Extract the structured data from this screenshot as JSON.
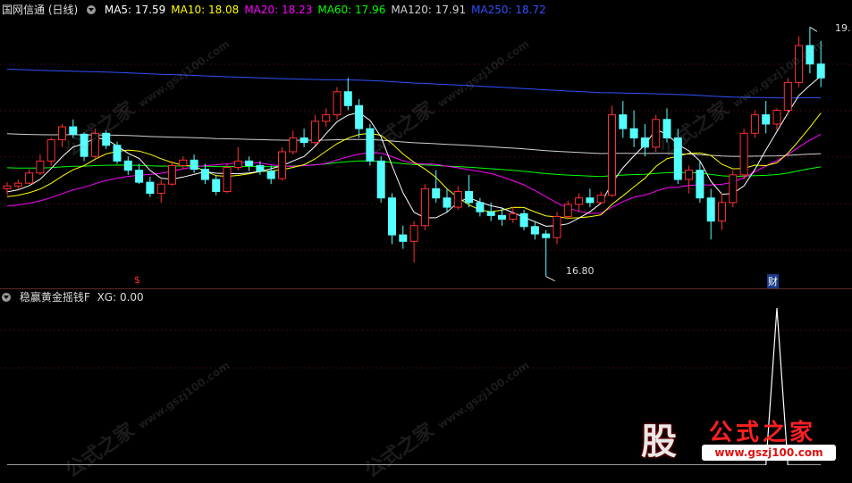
{
  "header": {
    "title": "国网信通 (日线)",
    "ma_items": [
      {
        "label": "MA5: 17.59",
        "color": "#ffffff"
      },
      {
        "label": "MA10: 18.08",
        "color": "#ffff00"
      },
      {
        "label": "MA20: 18.23",
        "color": "#ff00ff"
      },
      {
        "label": "MA60: 17.96",
        "color": "#00ff00"
      },
      {
        "label": "MA120: 17.91",
        "color": "#d0d0d0"
      },
      {
        "label": "MA250: 18.72",
        "color": "#3050ff"
      }
    ]
  },
  "indicator": {
    "title": "稳赢黄金摇钱F",
    "value_label": "XG: 0.00"
  },
  "annotations": {
    "high_label": "19.",
    "low_label": "16.80",
    "marker_s": "$",
    "marker_cai": "财"
  },
  "watermark": {
    "text": "公式之家",
    "url": "www.gszj100.com"
  },
  "logo": {
    "char": "股",
    "text": "公式之家",
    "url": "www.gszj100.com"
  },
  "colors": {
    "up": "#ff3030",
    "down": "#54ffff",
    "ma5": "#ffffff",
    "ma10": "#ffff00",
    "ma20": "#ff00ff",
    "ma60": "#00ff00",
    "ma120": "#d0d0d0",
    "ma250": "#3050ff"
  },
  "chart_data": [
    {
      "type": "candlestick",
      "title": "国网信通 (日线)",
      "series_ohlc": [
        [
          17.75,
          17.82,
          17.68,
          17.78
        ],
        [
          17.78,
          17.85,
          17.74,
          17.81
        ],
        [
          17.81,
          17.96,
          17.8,
          17.92
        ],
        [
          17.92,
          18.12,
          17.9,
          18.05
        ],
        [
          18.05,
          18.3,
          18.0,
          18.28
        ],
        [
          18.28,
          18.45,
          18.2,
          18.42
        ],
        [
          18.42,
          18.5,
          18.3,
          18.34
        ],
        [
          18.34,
          18.36,
          18.05,
          18.1
        ],
        [
          18.1,
          18.4,
          18.08,
          18.35
        ],
        [
          18.35,
          18.38,
          18.18,
          18.22
        ],
        [
          18.22,
          18.26,
          18.02,
          18.05
        ],
        [
          18.05,
          18.1,
          17.9,
          17.95
        ],
        [
          17.95,
          18.02,
          17.8,
          17.82
        ],
        [
          17.82,
          17.88,
          17.66,
          17.7
        ],
        [
          17.7,
          17.85,
          17.6,
          17.8
        ],
        [
          17.8,
          18.05,
          17.78,
          18.0
        ],
        [
          18.0,
          18.1,
          17.96,
          18.06
        ],
        [
          18.06,
          18.12,
          17.92,
          17.96
        ],
        [
          17.96,
          18.02,
          17.8,
          17.85
        ],
        [
          17.85,
          17.9,
          17.68,
          17.72
        ],
        [
          17.72,
          18.02,
          17.7,
          17.98
        ],
        [
          17.98,
          18.2,
          17.95,
          18.05
        ],
        [
          18.05,
          18.1,
          17.94,
          18.0
        ],
        [
          18.0,
          18.05,
          17.9,
          17.94
        ],
        [
          17.94,
          18.0,
          17.8,
          17.86
        ],
        [
          17.86,
          18.2,
          17.84,
          18.15
        ],
        [
          18.15,
          18.38,
          18.12,
          18.3
        ],
        [
          18.3,
          18.4,
          18.2,
          18.25
        ],
        [
          18.25,
          18.55,
          18.22,
          18.48
        ],
        [
          18.48,
          18.62,
          18.42,
          18.55
        ],
        [
          18.55,
          18.85,
          18.5,
          18.8
        ],
        [
          18.8,
          18.95,
          18.6,
          18.65
        ],
        [
          18.65,
          18.72,
          18.3,
          18.4
        ],
        [
          18.4,
          18.45,
          18.0,
          18.05
        ],
        [
          18.05,
          18.1,
          17.6,
          17.65
        ],
        [
          17.65,
          17.7,
          17.15,
          17.25
        ],
        [
          17.25,
          17.35,
          17.1,
          17.18
        ],
        [
          17.18,
          17.4,
          16.95,
          17.35
        ],
        [
          17.35,
          17.8,
          17.3,
          17.75
        ],
        [
          17.75,
          17.95,
          17.6,
          17.65
        ],
        [
          17.65,
          17.75,
          17.5,
          17.55
        ],
        [
          17.55,
          17.78,
          17.52,
          17.72
        ],
        [
          17.72,
          17.9,
          17.55,
          17.6
        ],
        [
          17.6,
          17.65,
          17.45,
          17.5
        ],
        [
          17.5,
          17.6,
          17.4,
          17.46
        ],
        [
          17.46,
          17.55,
          17.35,
          17.42
        ],
        [
          17.42,
          17.55,
          17.38,
          17.48
        ],
        [
          17.48,
          17.52,
          17.3,
          17.34
        ],
        [
          17.34,
          17.4,
          17.2,
          17.26
        ],
        [
          17.26,
          17.3,
          16.8,
          17.22
        ],
        [
          17.22,
          17.5,
          17.15,
          17.45
        ],
        [
          17.45,
          17.62,
          17.42,
          17.58
        ],
        [
          17.58,
          17.7,
          17.5,
          17.65
        ],
        [
          17.65,
          17.75,
          17.55,
          17.6
        ],
        [
          17.6,
          17.72,
          17.58,
          17.68
        ],
        [
          17.68,
          18.65,
          17.66,
          18.55
        ],
        [
          18.55,
          18.7,
          18.3,
          18.4
        ],
        [
          18.4,
          18.6,
          18.2,
          18.3
        ],
        [
          18.3,
          18.45,
          18.1,
          18.2
        ],
        [
          18.2,
          18.55,
          18.15,
          18.5
        ],
        [
          18.5,
          18.62,
          18.25,
          18.3
        ],
        [
          18.3,
          18.4,
          17.8,
          17.85
        ],
        [
          17.85,
          18.0,
          17.7,
          17.95
        ],
        [
          17.95,
          18.05,
          17.6,
          17.65
        ],
        [
          17.65,
          17.75,
          17.2,
          17.4
        ],
        [
          17.4,
          17.7,
          17.3,
          17.6
        ],
        [
          17.6,
          17.95,
          17.55,
          17.9
        ],
        [
          17.9,
          18.4,
          17.85,
          18.35
        ],
        [
          18.35,
          18.6,
          18.3,
          18.55
        ],
        [
          18.55,
          18.7,
          18.35,
          18.45
        ],
        [
          18.45,
          18.62,
          18.38,
          18.6
        ],
        [
          18.6,
          18.95,
          18.55,
          18.9
        ],
        [
          18.9,
          19.4,
          18.85,
          19.3
        ],
        [
          19.3,
          19.5,
          19.0,
          19.1
        ],
        [
          19.1,
          19.35,
          18.85,
          18.95
        ]
      ],
      "ma_series": [
        {
          "name": "MA5"
        },
        {
          "name": "MA10"
        },
        {
          "name": "MA20"
        },
        {
          "name": "MA60"
        },
        {
          "name": "MA120"
        },
        {
          "name": "MA250"
        }
      ],
      "price_range": [
        16.7,
        19.6
      ],
      "high_mark": 19.5,
      "low_mark": 16.8
    },
    {
      "type": "line",
      "title": "稳赢黄金摇钱F",
      "series": [
        {
          "name": "XG",
          "values": [
            0,
            0,
            0,
            0,
            0,
            0,
            0,
            0,
            0,
            0,
            0,
            0,
            0,
            0,
            0,
            0,
            0,
            0,
            0,
            0,
            0,
            0,
            0,
            0,
            0,
            0,
            0,
            0,
            0,
            0,
            0,
            0,
            0,
            0,
            0,
            0,
            0,
            0,
            0,
            0,
            0,
            0,
            0,
            0,
            0,
            0,
            0,
            0,
            0,
            0,
            0,
            0,
            0,
            0,
            0,
            0,
            0,
            0,
            0,
            0,
            0,
            0,
            0,
            0,
            0,
            0,
            0,
            0,
            0,
            0,
            1,
            0,
            0,
            0,
            0
          ]
        }
      ],
      "ylim": [
        0,
        1
      ]
    }
  ]
}
